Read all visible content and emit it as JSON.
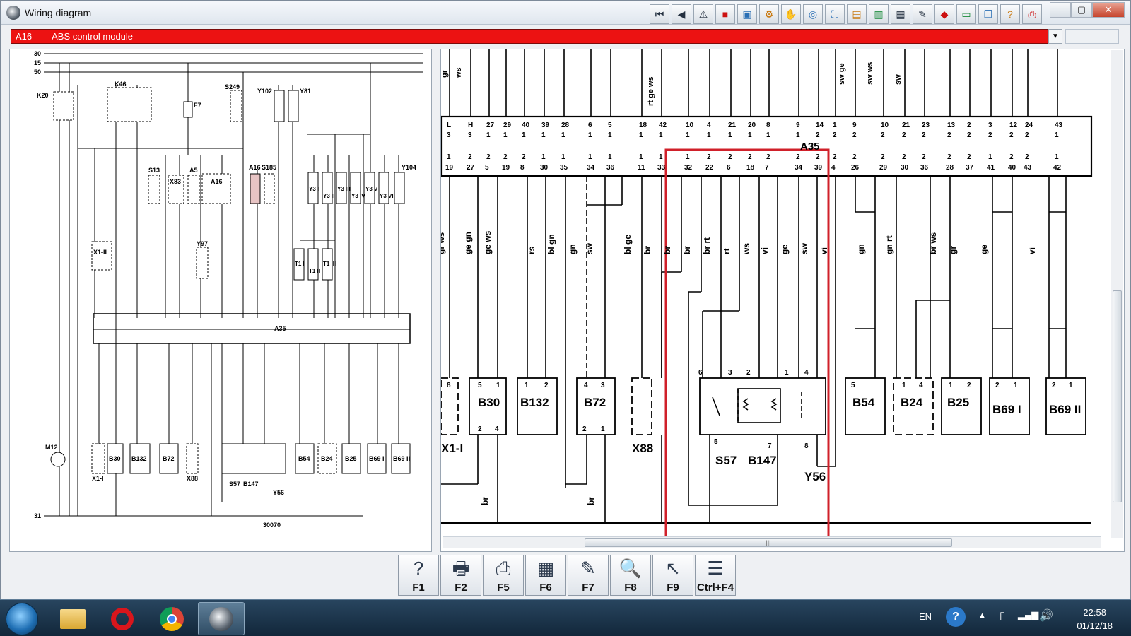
{
  "window": {
    "title": "Wiring diagram"
  },
  "toolbar": {
    "icons": [
      "first-page-icon",
      "prev-page-icon",
      "warning-icon",
      "color-icon",
      "panel-icon",
      "settings-icon",
      "hand-icon",
      "zoom-icon",
      "map-icon",
      "folder-icon",
      "save-icon",
      "table-icon",
      "pen-icon",
      "car-icon",
      "monitor-icon",
      "window-icon",
      "help-icon",
      "print-icon"
    ]
  },
  "component": {
    "id": "A16",
    "name": "ABS control module"
  },
  "left_diagram": {
    "bus_labels": [
      "30",
      "15",
      "50"
    ],
    "ground_label": "31",
    "page_number": "30070",
    "connector_label": "A35",
    "top_components": [
      "K20",
      "K46",
      "F7",
      "S249",
      "Y102",
      "Y81",
      "Y104"
    ],
    "mid_components": [
      "S13",
      "X83",
      "A5",
      "A16",
      "S185",
      "Y3 I",
      "Y3 II",
      "Y3 III",
      "Y3 IV",
      "Y3 V",
      "Y3 VI"
    ],
    "other_components": [
      "X1-II",
      "Y97",
      "T1 I",
      "T1 II",
      "T1 III",
      "M12"
    ],
    "bottom_components": [
      "X1-I",
      "B30",
      "B132",
      "B72",
      "X88",
      "S57",
      "B147",
      "Y56",
      "B54",
      "B24",
      "B25",
      "B69 I",
      "B69 II"
    ]
  },
  "right_diagram": {
    "connector_label": "A35",
    "top_wire_colors": [
      "gr",
      "ws",
      "rt ge ws",
      "sw ge",
      "sw ws",
      "sw"
    ],
    "pin_top_row": [
      "L",
      "H",
      "27",
      "29",
      "40",
      "39",
      "28",
      "6",
      "5",
      "18",
      "42",
      "10",
      "4",
      "21",
      "20",
      "8",
      "9",
      "14",
      "1",
      "9",
      "10",
      "21",
      "23",
      "13",
      "2",
      "3",
      "12",
      "24",
      "43"
    ],
    "pin_top_row2": [
      "3",
      "3",
      "1",
      "1",
      "1",
      "1",
      "1",
      "1",
      "1",
      "1",
      "1",
      "1",
      "1",
      "1",
      "1",
      "1",
      "1",
      "2",
      "2",
      "2",
      "2",
      "2",
      "2",
      "2",
      "2",
      "2",
      "2",
      "2",
      "1"
    ],
    "pin_bottom_row": [
      "19",
      "27",
      "5",
      "19",
      "8",
      "30",
      "35",
      "34",
      "36",
      "11",
      "33",
      "32",
      "22",
      "6",
      "18",
      "7",
      "34",
      "39",
      "4",
      "26",
      "29",
      "30",
      "36",
      "28",
      "37",
      "41",
      "40",
      "43",
      "42"
    ],
    "pin_bottom_row_prefix": [
      "1",
      "2",
      "2",
      "2",
      "2",
      "1",
      "1",
      "1",
      "1",
      "1",
      "1",
      "1",
      "2",
      "2",
      "2",
      "2",
      "2",
      "2",
      "2",
      "2",
      "2",
      "2",
      "2",
      "2",
      "2",
      "1",
      "2",
      "2",
      "1"
    ],
    "wire_colors": [
      "gr ws",
      "ge gn",
      "ge ws",
      "rs",
      "bl gn",
      "gn",
      "sw",
      "bl ge",
      "br",
      "br",
      "br",
      "br rt",
      "rt",
      "ws",
      "vi",
      "ge",
      "sw",
      "vi",
      "gn",
      "gn rt",
      "br ws",
      "gr",
      "ge",
      "vi"
    ],
    "bottom_wire_colors": [
      "br",
      "br"
    ],
    "components": [
      {
        "name": "X1-I",
        "pins": [
          "8"
        ]
      },
      {
        "name": "B30",
        "pins": [
          "5",
          "1",
          "2",
          "4"
        ]
      },
      {
        "name": "B132",
        "pins": [
          "1",
          "2"
        ]
      },
      {
        "name": "B72",
        "pins": [
          "4",
          "3",
          "2",
          "1"
        ]
      },
      {
        "name": "X88",
        "pins": []
      },
      {
        "name": "S57",
        "pins": [
          "6",
          "5"
        ]
      },
      {
        "name": "B147",
        "pins": [
          "3",
          "2",
          "7"
        ]
      },
      {
        "name": "Y56",
        "pins": [
          "1",
          "4",
          "8"
        ]
      },
      {
        "name": "B54",
        "pins": [
          "5"
        ]
      },
      {
        "name": "B24",
        "pins": [
          "1",
          "4"
        ]
      },
      {
        "name": "B25",
        "pins": [
          "1",
          "2"
        ]
      },
      {
        "name": "B69 I",
        "pins": [
          "2",
          "1"
        ]
      },
      {
        "name": "B69 II",
        "pins": [
          "2",
          "1"
        ]
      }
    ],
    "highlight_color": "#d0202a"
  },
  "function_keys": [
    {
      "label": "F1",
      "icon": "help-icon",
      "glyph": "?"
    },
    {
      "label": "F2",
      "icon": "printer-icon",
      "glyph": "🖶"
    },
    {
      "label": "F5",
      "icon": "print-icon",
      "glyph": "⎙"
    },
    {
      "label": "F6",
      "icon": "layout-icon",
      "glyph": "▦"
    },
    {
      "label": "F7",
      "icon": "pen-icon",
      "glyph": "✎"
    },
    {
      "label": "F8",
      "icon": "search-icon",
      "glyph": "🔍"
    },
    {
      "label": "F9",
      "icon": "cursor-icon",
      "glyph": "↖"
    },
    {
      "label": "Ctrl+F4",
      "icon": "list-icon",
      "glyph": "☰"
    }
  ],
  "taskbar": {
    "language": "EN",
    "time": "22:58",
    "date": "01/12/18"
  }
}
